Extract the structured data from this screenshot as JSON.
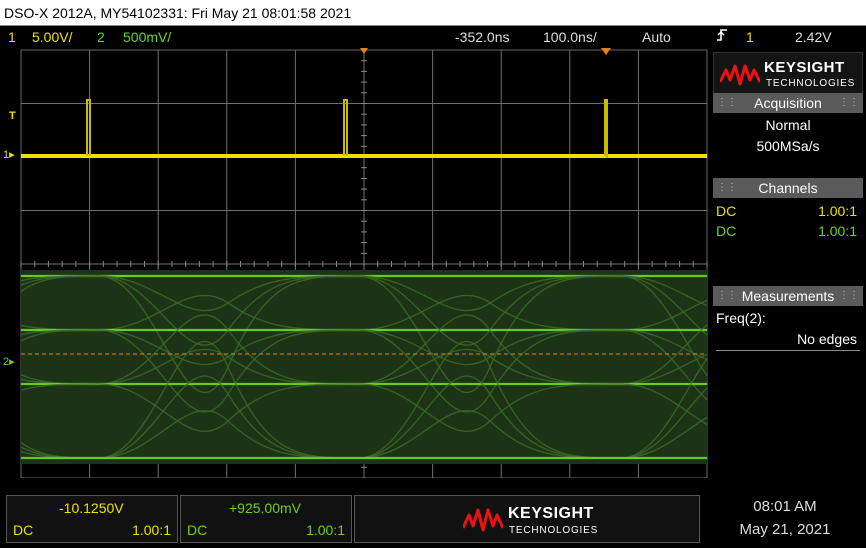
{
  "title": "DSO-X 2012A, MY54102331: Fri May 21 08:01:58 2021",
  "status": {
    "ch1_num": "1",
    "ch1_scale": "5.00V/",
    "ch2_num": "2",
    "ch2_scale": "500mV/",
    "time_offset": "-352.0ns",
    "time_scale": "100.0ns/",
    "trigger_mode": "Auto",
    "trigger_icon": "rising-edge",
    "trigger_source": "1",
    "trigger_level": "2.42V"
  },
  "markers": {
    "trigger_label": "T",
    "ch1_label": "1",
    "ch2_label": "2"
  },
  "side": {
    "brand": "KEYSIGHT",
    "brand_sub": "TECHNOLOGIES",
    "acquisition": {
      "title": "Acquisition",
      "mode": "Normal",
      "rate": "500MSa/s"
    },
    "channels": {
      "title": "Channels",
      "rows": [
        {
          "coupling": "DC",
          "probe": "1.00:1",
          "color": "#f0e000"
        },
        {
          "coupling": "DC",
          "probe": "1.00:1",
          "color": "#6ad31c"
        }
      ]
    },
    "measurements": {
      "title": "Measurements",
      "label": "Freq(2):",
      "value": "No edges"
    }
  },
  "bottom": {
    "ch1": {
      "value": "-10.1250V",
      "coupling": "DC",
      "probe": "1.00:1"
    },
    "ch2": {
      "value": "+925.00mV",
      "coupling": "DC",
      "probe": "1.00:1"
    },
    "brand": "KEYSIGHT",
    "brand_sub": "TECHNOLOGIES",
    "time": "08:01 AM",
    "date": "May 21, 2021"
  },
  "colors": {
    "ch1": "#f0e000",
    "ch2": "#6ad31c",
    "ch2_dim": "#3d6b2a",
    "grid": "#6f6f6f",
    "ref_line": "#e8801a"
  }
}
